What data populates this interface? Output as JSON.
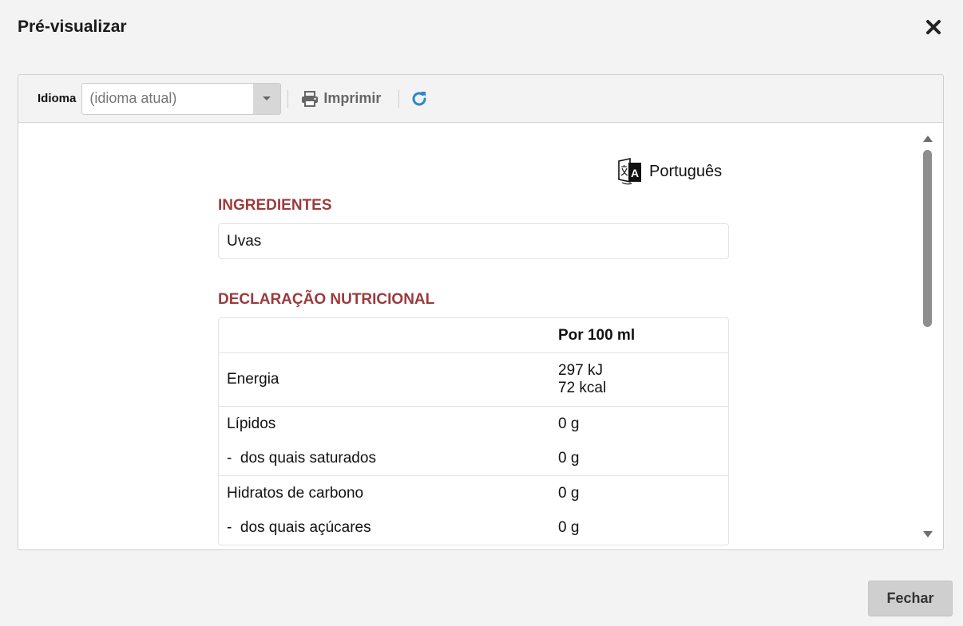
{
  "dialog": {
    "title": "Pré-visualizar",
    "close_label": "Fechar"
  },
  "toolbar": {
    "language_label": "Idioma",
    "language_placeholder": "(idioma atual)",
    "print_label": "Imprimir"
  },
  "document": {
    "language": "Português",
    "ingredients_title": "INGREDIENTES",
    "ingredients": "Uvas",
    "nutrition_title": "DECLARAÇÃO NUTRICIONAL",
    "nutrition": {
      "header": "Por 100 ml",
      "energy": {
        "name": "Energia",
        "kj": "297 kJ",
        "kcal": "72 kcal"
      },
      "fats": {
        "name": "Lípidos",
        "value": "0 g",
        "sub_name": "-  dos quais saturados",
        "sub_value": "0 g"
      },
      "carbs": {
        "name": "Hidratos de carbono",
        "value": "0 g",
        "sub_name": "-  dos quais açúcares",
        "sub_value": "0 g"
      }
    }
  },
  "icons": {
    "close": "close-icon",
    "dropdown": "chevron-down-icon",
    "print": "printer-icon",
    "refresh": "refresh-icon",
    "language": "translate-icon"
  },
  "colors": {
    "section_title": "#9b3a3d",
    "refresh": "#2f86c9"
  }
}
